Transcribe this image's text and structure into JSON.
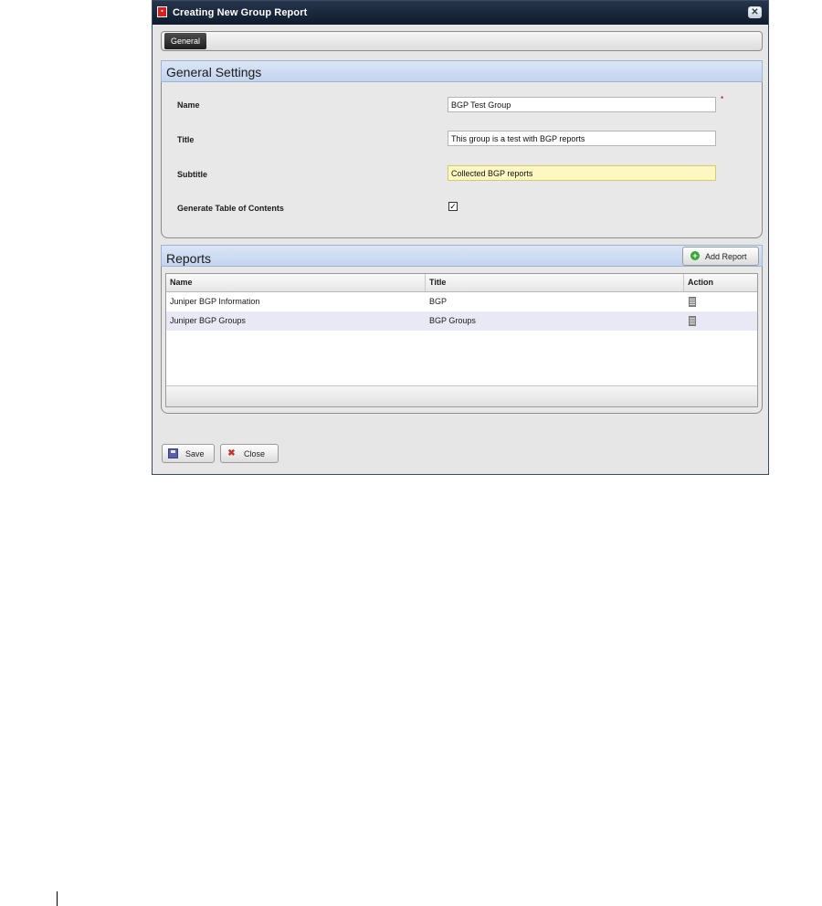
{
  "window": {
    "title": "Creating New Group Report",
    "close_glyph": "✕"
  },
  "tabs": [
    {
      "label": "General"
    }
  ],
  "general_settings": {
    "header": "General Settings",
    "fields": {
      "name": {
        "label": "Name",
        "value": "BGP Test Group",
        "required_mark": "*"
      },
      "title": {
        "label": "Title",
        "value": "This group is a test with BGP reports"
      },
      "subtitle": {
        "label": "Subtitle",
        "value": "Collected BGP reports"
      },
      "toc": {
        "label": "Generate Table of Contents",
        "checked": true,
        "check_glyph": "✓"
      }
    }
  },
  "reports": {
    "header": "Reports",
    "add_button": "Add Report",
    "columns": {
      "name": "Name",
      "title": "Title",
      "action": "Action"
    },
    "rows": [
      {
        "name": "Juniper BGP Information",
        "title": "BGP",
        "action_icon": "edit-icon"
      },
      {
        "name": "Juniper BGP Groups",
        "title": "BGP Groups",
        "action_icon": "edit-icon"
      }
    ]
  },
  "footer": {
    "save": "Save",
    "close": "Close"
  },
  "colors": {
    "title_bar": "#1a2a40",
    "section_header": "#c9d8f0",
    "highlight_field": "#fdf8c2",
    "alt_row": "#e9e8f5"
  }
}
